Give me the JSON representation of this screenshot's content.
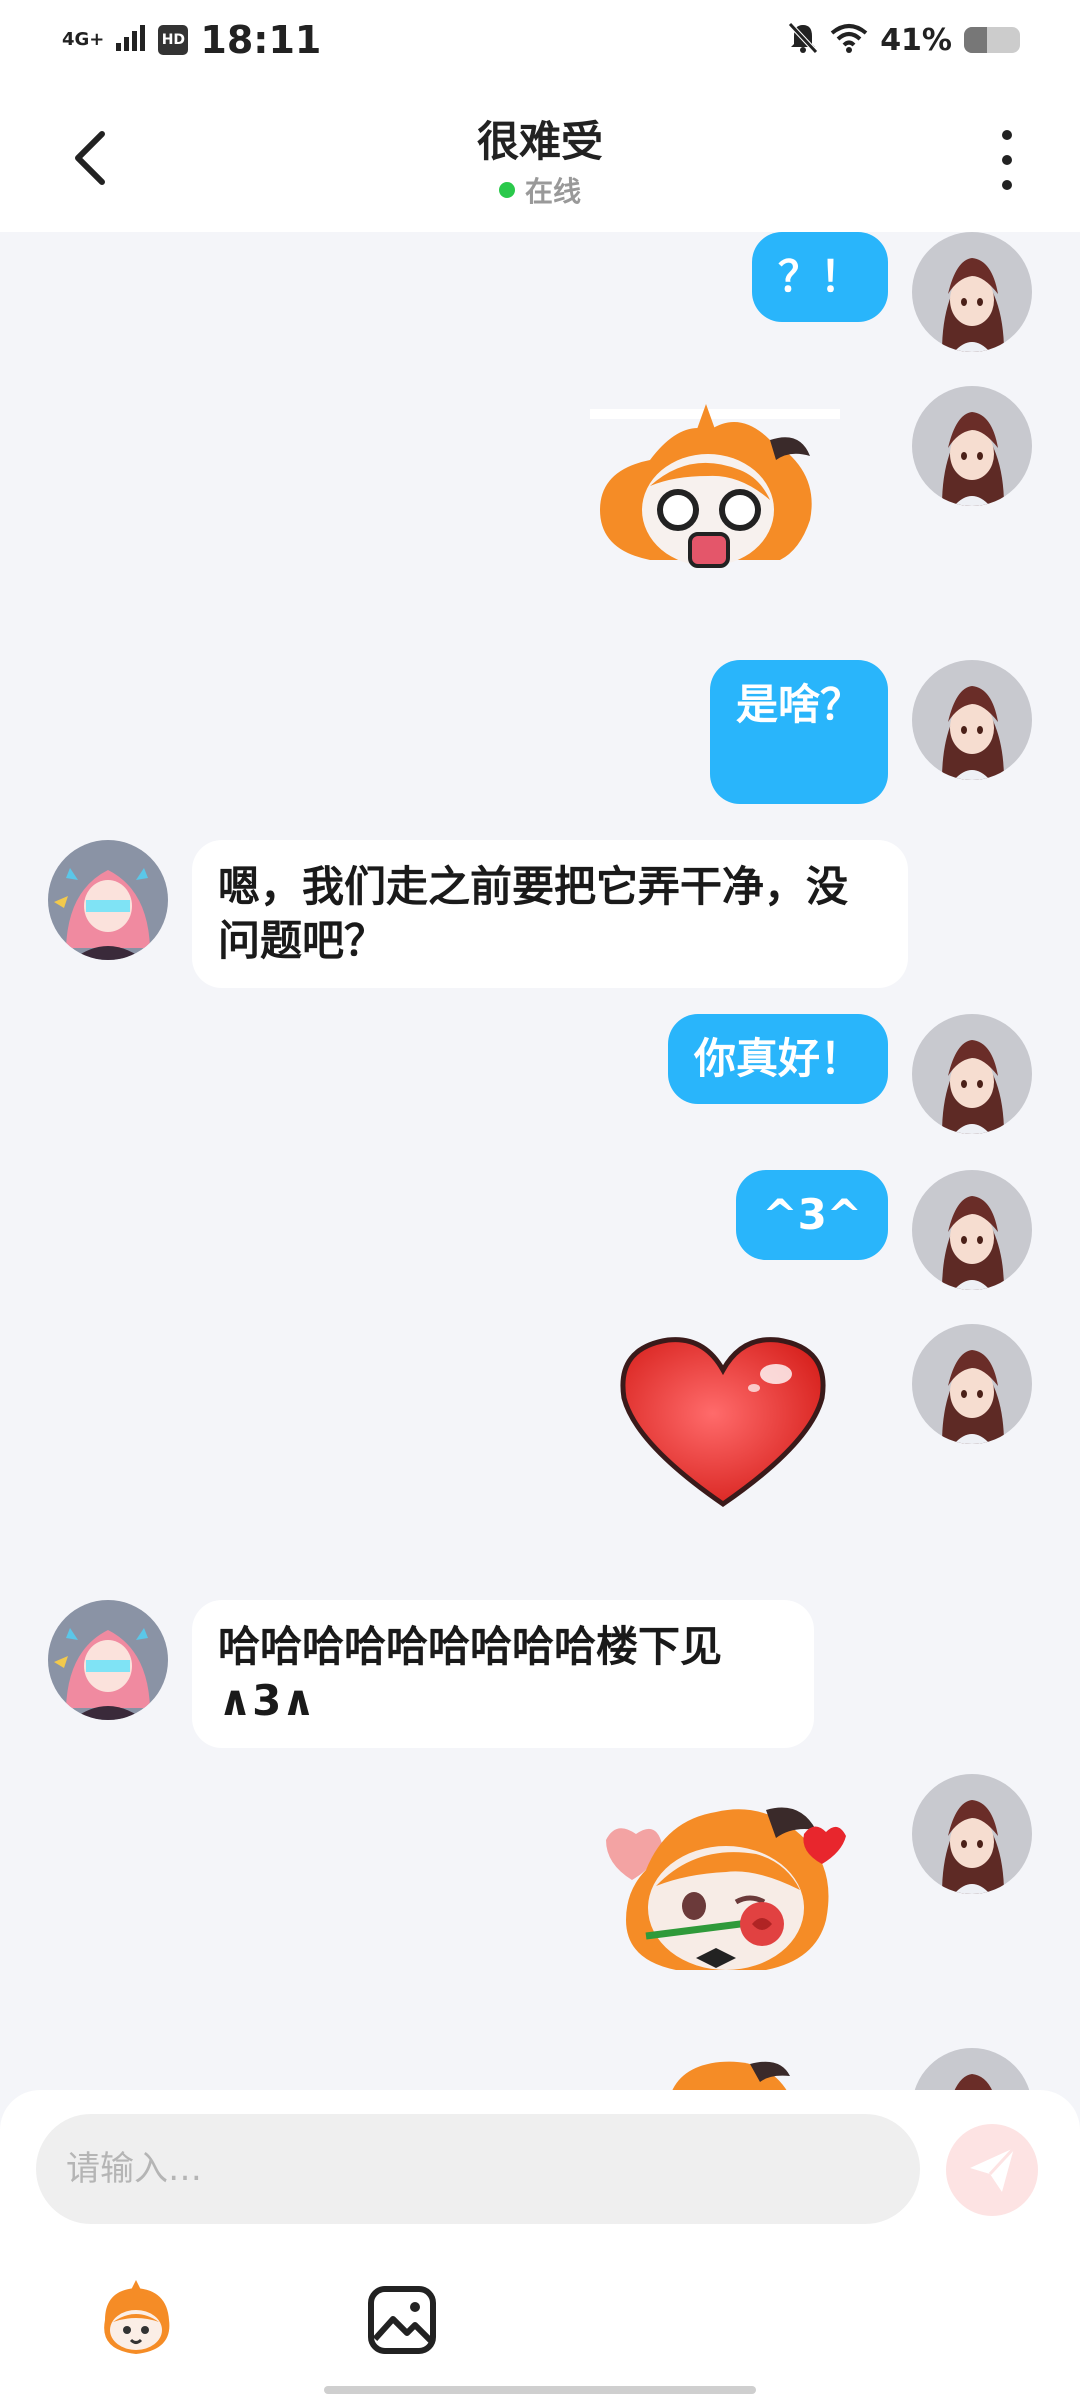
{
  "status_bar": {
    "network": "4G+",
    "hd_badge": "HD",
    "time": "18:11",
    "battery_text": "41%",
    "battery_level": 0.41,
    "icons": [
      "mute-icon",
      "wifi-icon",
      "battery-icon"
    ]
  },
  "header": {
    "title": "很难受",
    "status": "在线",
    "status_color": "#2ac94b"
  },
  "messages": [
    {
      "from": "me",
      "type": "text",
      "text": "？！"
    },
    {
      "from": "me",
      "type": "sticker",
      "sticker": "shocked-orange-creature-sticker"
    },
    {
      "from": "me",
      "type": "text",
      "text": "是啥？"
    },
    {
      "from": "them",
      "type": "text",
      "text": "嗯，我们走之前要把它弄干净，没问题吧？"
    },
    {
      "from": "me",
      "type": "text",
      "text": "你真好！"
    },
    {
      "from": "me",
      "type": "text",
      "text": "^3^"
    },
    {
      "from": "me",
      "type": "sticker",
      "sticker": "red-heart-sticker"
    },
    {
      "from": "them",
      "type": "text",
      "text": "哈哈哈哈哈哈哈哈哈楼下见∧3∧"
    },
    {
      "from": "me",
      "type": "sticker",
      "sticker": "rose-in-mouth-creature-sticker"
    },
    {
      "from": "me",
      "type": "sticker",
      "sticker": "orange-creature-sticker-partial"
    }
  ],
  "input": {
    "placeholder": "请输入…"
  },
  "toolbar": {
    "sticker_button_icon": "orange-creature-icon",
    "image_button_icon": "image-icon"
  },
  "colors": {
    "my_bubble": "#29b5fb",
    "their_bubble": "#ffffff",
    "background": "#f4f5f9",
    "send_button": "#fde3e3"
  }
}
